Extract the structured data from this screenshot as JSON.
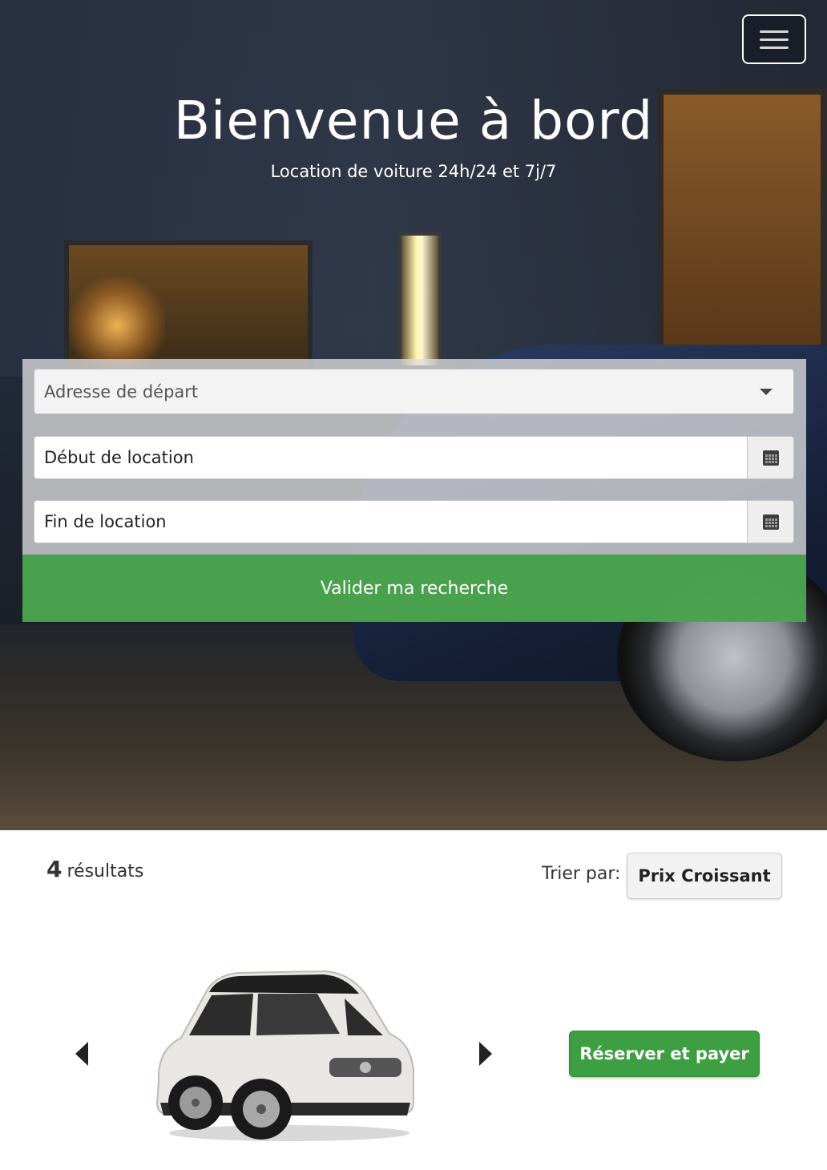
{
  "hero": {
    "title": "Bienvenue à bord",
    "subtitle": "Location de voiture 24h/24 et 7j/7",
    "menu_icon": "hamburger-icon"
  },
  "search": {
    "address_placeholder": "Adresse de départ",
    "start_placeholder": "Début de location",
    "end_placeholder": "Fin de location",
    "calendar_icon": "calendar-icon",
    "submit_label": "Valider ma recherche",
    "submit_color": "#40a044"
  },
  "results": {
    "count": "4",
    "count_label": "résultats",
    "sort_label": "Trier par:",
    "sort_value": "Prix Croissant",
    "reserve_label": "Réserver et payer",
    "reserve_color": "#3d9f41",
    "prev_icon": "chevron-left-icon",
    "next_icon": "chevron-right-icon"
  }
}
